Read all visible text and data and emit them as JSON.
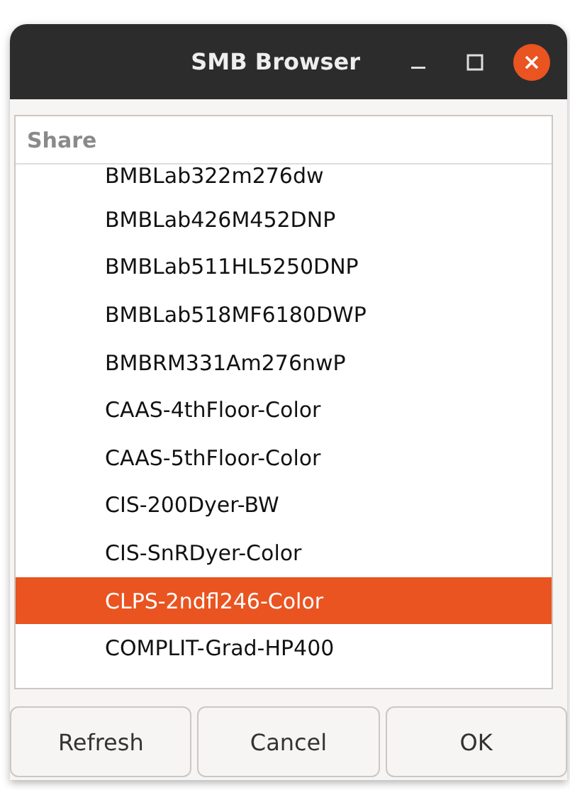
{
  "window": {
    "title": "SMB Browser"
  },
  "list": {
    "column": "Share",
    "rows": [
      {
        "label": "BMBLab322m276dw",
        "selected": false
      },
      {
        "label": "BMBLab426M452DNP",
        "selected": false
      },
      {
        "label": "BMBLab511HL5250DNP",
        "selected": false
      },
      {
        "label": "BMBLab518MF6180DWP",
        "selected": false
      },
      {
        "label": "BMBRM331Am276nwP",
        "selected": false
      },
      {
        "label": "CAAS-4thFloor-Color",
        "selected": false
      },
      {
        "label": "CAAS-5thFloor-Color",
        "selected": false
      },
      {
        "label": "CIS-200Dyer-BW",
        "selected": false
      },
      {
        "label": "CIS-SnRDyer-Color",
        "selected": false
      },
      {
        "label": "CLPS-2ndfl246-Color",
        "selected": true
      },
      {
        "label": "COMPLIT-Grad-HP400",
        "selected": false
      }
    ]
  },
  "buttons": [
    "Refresh",
    "Cancel",
    "OK"
  ]
}
